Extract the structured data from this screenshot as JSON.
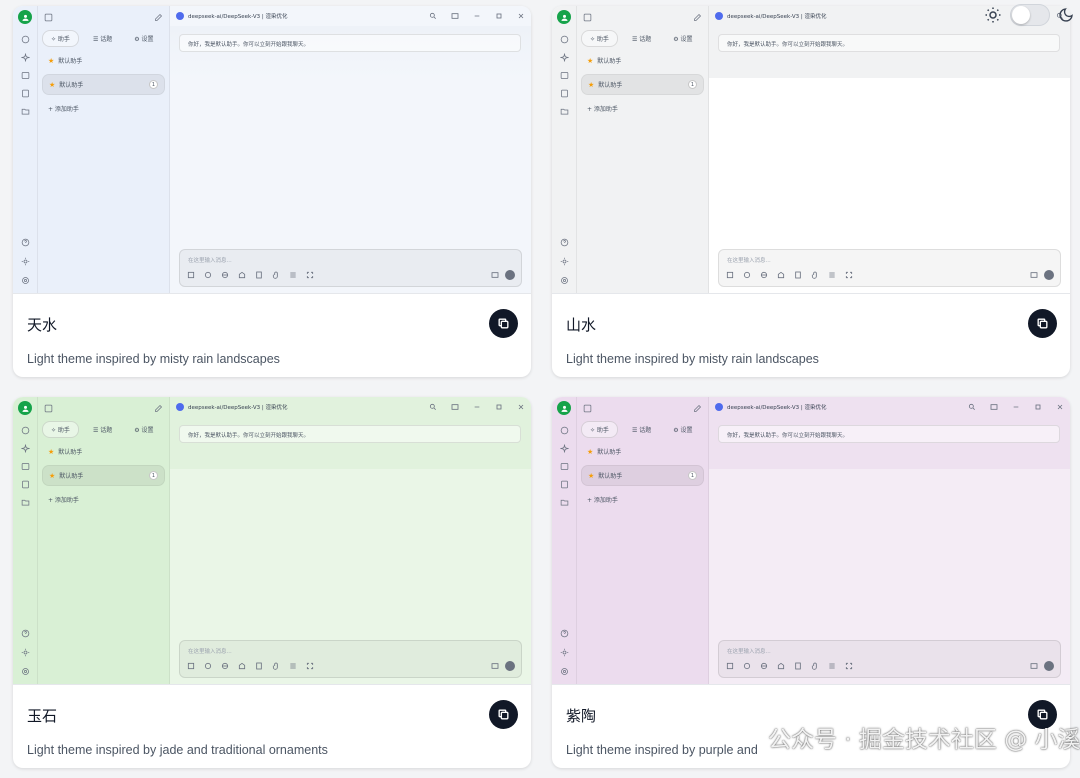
{
  "themes": [
    {
      "name": "天水",
      "description": "Light theme inspired by misty rain landscapes",
      "preview": {
        "tabs": [
          "✧ 助手",
          "☰ 话题",
          "⚙ 设置"
        ],
        "items": [
          "默认助手",
          "默认助手"
        ],
        "item_count": "1",
        "add_label": "+ 添加助手",
        "model_title": "deepseek-ai/DeepSeek-V3 | 渲染优化",
        "greeting": "你好，我是默认助手。你可以立刻开始跟我聊天。",
        "input_placeholder": "在这里输入消息..."
      }
    },
    {
      "name": "山水",
      "description": "Light theme inspired by misty rain landscapes",
      "preview": {
        "tabs": [
          "✧ 助手",
          "☰ 话题",
          "⚙ 设置"
        ],
        "items": [
          "默认助手",
          "默认助手"
        ],
        "item_count": "1",
        "add_label": "+ 添加助手",
        "model_title": "deepseek-ai/DeepSeek-V3 | 渲染优化",
        "greeting": "你好，我是默认助手。你可以立刻开始跟我聊天。",
        "input_placeholder": "在这里输入消息..."
      }
    },
    {
      "name": "玉石",
      "description": "Light theme inspired by jade and traditional ornaments",
      "preview": {
        "tabs": [
          "✧ 助手",
          "☰ 话题",
          "⚙ 设置"
        ],
        "items": [
          "默认助手",
          "默认助手"
        ],
        "item_count": "1",
        "add_label": "+ 添加助手",
        "model_title": "deepseek-ai/DeepSeek-V3 | 渲染优化",
        "greeting": "你好，我是默认助手。你可以立刻开始跟我聊天。",
        "input_placeholder": "在这里输入消息..."
      }
    },
    {
      "name": "紫陶",
      "description": "Light theme inspired by purple and",
      "preview": {
        "tabs": [
          "✧ 助手",
          "☰ 话题",
          "⚙ 设置"
        ],
        "items": [
          "默认助手",
          "默认助手"
        ],
        "item_count": "1",
        "add_label": "+ 添加助手",
        "model_title": "deepseek-ai/DeepSeek-V3 | 渲染优化",
        "greeting": "你好，我是默认助手。你可以立刻开始跟我聊天。",
        "input_placeholder": "在这里输入消息..."
      }
    }
  ],
  "watermark": "公众号 · 掘金技术社区 @ 小溪彼岸",
  "icons": [
    "sun-icon",
    "moon-icon",
    "copy-icon",
    "avatar-icon",
    "chat-icon",
    "sparkle-icon",
    "image-icon",
    "translate-icon",
    "folder-icon",
    "help-icon",
    "brightness-icon",
    "settings-icon",
    "search-icon",
    "minimize-icon",
    "maximize-icon",
    "close-icon"
  ]
}
